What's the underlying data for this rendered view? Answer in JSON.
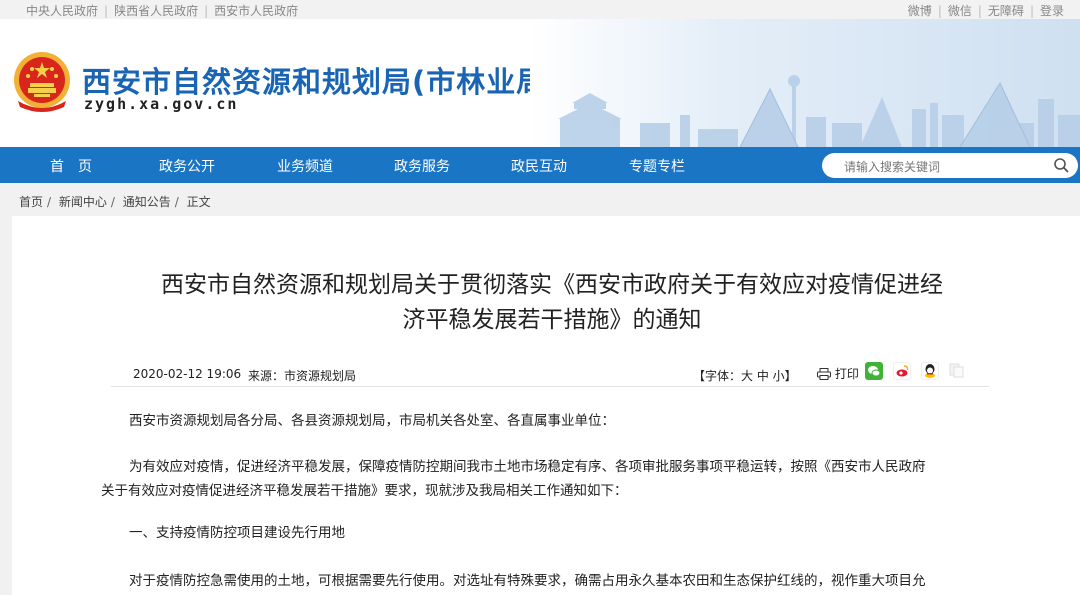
{
  "topbar": {
    "links": [
      "中央人民政府",
      "陕西省人民政府",
      "西安市人民政府"
    ],
    "right_links": [
      "微博",
      "微信",
      "无障碍",
      "登录"
    ]
  },
  "header": {
    "title": "西安市自然资源和规划局(市林业局)",
    "domain": "zygh.xa.gov.cn"
  },
  "nav": {
    "items": [
      "首　页",
      "政务公开",
      "业务频道",
      "政务服务",
      "政民互动",
      "专题专栏"
    ],
    "search_placeholder": "请输入搜索关键词"
  },
  "breadcrumb": [
    "首页",
    "新闻中心",
    "通知公告",
    "正文"
  ],
  "article": {
    "title_line1": "西安市自然资源和规划局关于贯彻落实《西安市政府关于有效应对疫情促进经",
    "title_line2": "济平稳发展若干措施》的通知",
    "date": "2020-02-12 19:06",
    "source": "来源：市资源规划局",
    "font_size": "【字体：大 中 小】",
    "print": "打印",
    "paragraphs": [
      "西安市资源规划局各分局、各县资源规划局，市局机关各处室、各直属事业单位：",
      "为有效应对疫情，促进经济平稳发展，保障疫情防控期间我市土地市场稳定有序、各项审批服务事项平稳运转，按照《西安市人民政府",
      "关于有效应对疫情促进经济平稳发展若干措施》要求，现就涉及我局相关工作通知如下：",
      "一、支持疫情防控项目建设先行用地",
      "对于疫情防控急需使用的土地，可根据需要先行使用。对选址有特殊要求，确需占用永久基本农田和生态保护红线的，视作重大项目允"
    ]
  },
  "colors": {
    "nav_blue": "#1a76c4",
    "title_blue": "#1a64b4"
  }
}
